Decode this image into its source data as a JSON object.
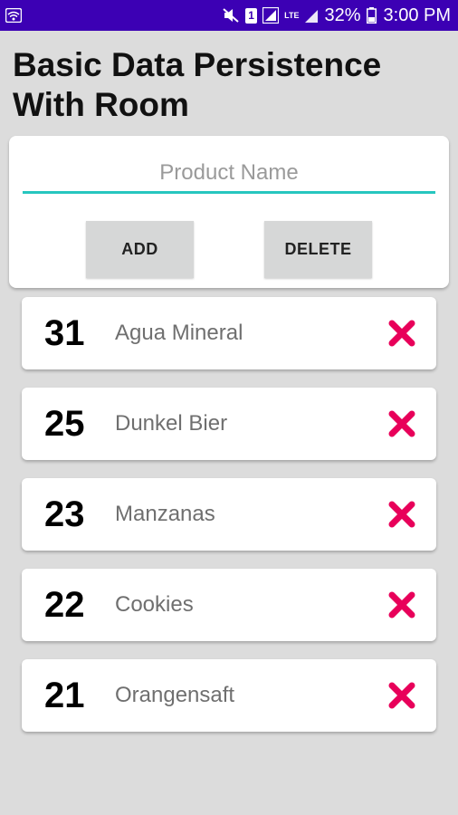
{
  "status_bar": {
    "battery_percent": "32%",
    "time": "3:00 PM",
    "network": "LTE",
    "sim": "1",
    "icons": [
      "wifi-icon",
      "mute-icon",
      "sim-icon",
      "signal-icon",
      "lte-icon",
      "signal-icon",
      "battery-icon"
    ]
  },
  "app": {
    "title": "Basic Data Persistence With Room"
  },
  "form": {
    "input_placeholder": "Product Name",
    "input_value": "",
    "add_label": "ADD",
    "delete_label": "DELETE"
  },
  "products": [
    {
      "id": "31",
      "name": "Agua Mineral"
    },
    {
      "id": "25",
      "name": "Dunkel Bier"
    },
    {
      "id": "23",
      "name": "Manzanas"
    },
    {
      "id": "22",
      "name": "Cookies"
    },
    {
      "id": "21",
      "name": "Orangensaft"
    }
  ],
  "colors": {
    "status_bar": "#3c00b4",
    "accent": "#26c6bf",
    "delete_icon": "#e8005a",
    "background": "#dcdcdc"
  }
}
